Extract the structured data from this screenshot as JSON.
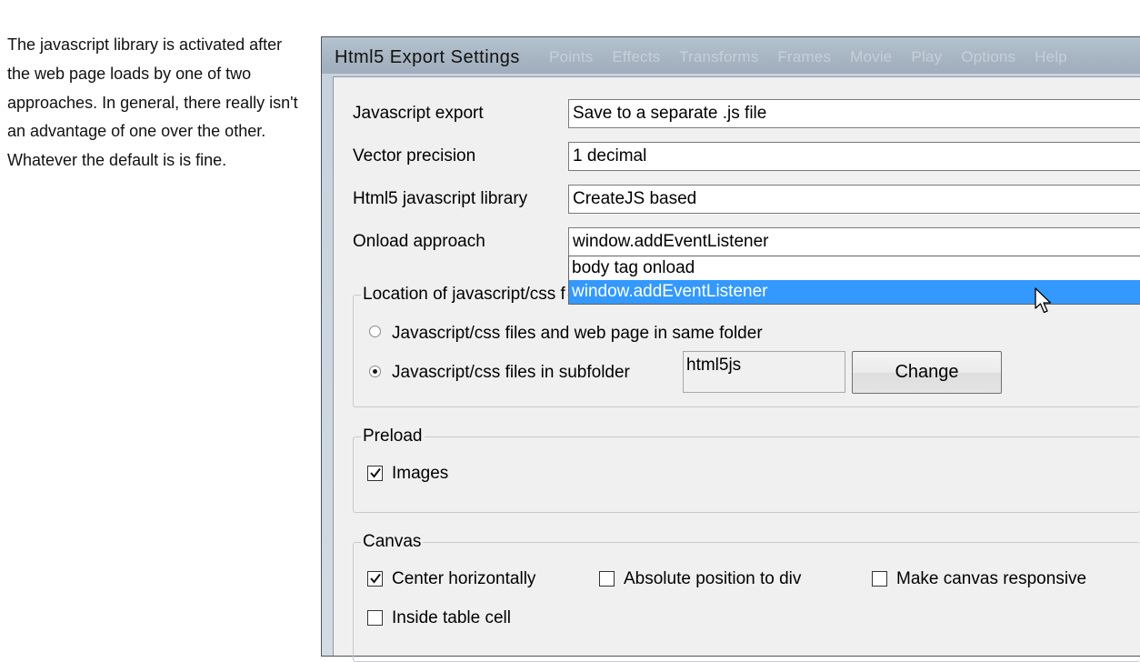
{
  "intro_text": "The javascript library is activated after the web page loads by one of two approaches. In general, there really isn't an advantage of one over the other. Whatever the default is is fine.",
  "window": {
    "title": "Html5 Export Settings",
    "background_menu": [
      "Points",
      "Effects",
      "Transforms",
      "Frames",
      "Movie",
      "Play",
      "Options",
      "Help"
    ]
  },
  "fields": {
    "javascript_export": {
      "label": "Javascript export",
      "value": "Save to a separate .js file"
    },
    "vector_precision": {
      "label": "Vector precision",
      "value": "1 decimal"
    },
    "js_library": {
      "label": "Html5 javascript library",
      "value": "CreateJS based"
    },
    "onload_approach": {
      "label": "Onload approach",
      "value": "window.addEventListener"
    }
  },
  "onload_dropdown": {
    "options": [
      "body tag onload",
      "window.addEventListener"
    ],
    "highlighted": "window.addEventListener"
  },
  "location_group": {
    "title": "Location of javascript/css f",
    "same_folder_label": "Javascript/css files and web page in same folder",
    "subfolder_label": "Javascript/css files in subfolder",
    "selected": "subfolder",
    "folder_name": "html5js",
    "change_button": "Change"
  },
  "preload_group": {
    "title": "Preload",
    "images_label": "Images",
    "images_checked": true
  },
  "canvas_group": {
    "title": "Canvas",
    "center_horizontally": {
      "label": "Center horizontally",
      "checked": true
    },
    "absolute_position": {
      "label": "Absolute position to div",
      "checked": false
    },
    "responsive": {
      "label": "Make canvas responsive",
      "checked": false
    },
    "inside_table_cell": {
      "label": "Inside table cell",
      "checked": false
    }
  },
  "colors": {
    "highlight": "#3399ff",
    "dialog_face": "#f0f0f0"
  },
  "icons": {
    "cursor": "mouse-pointer-icon",
    "radio": "radio-button-icon",
    "checkbox": "checkbox-icon"
  }
}
